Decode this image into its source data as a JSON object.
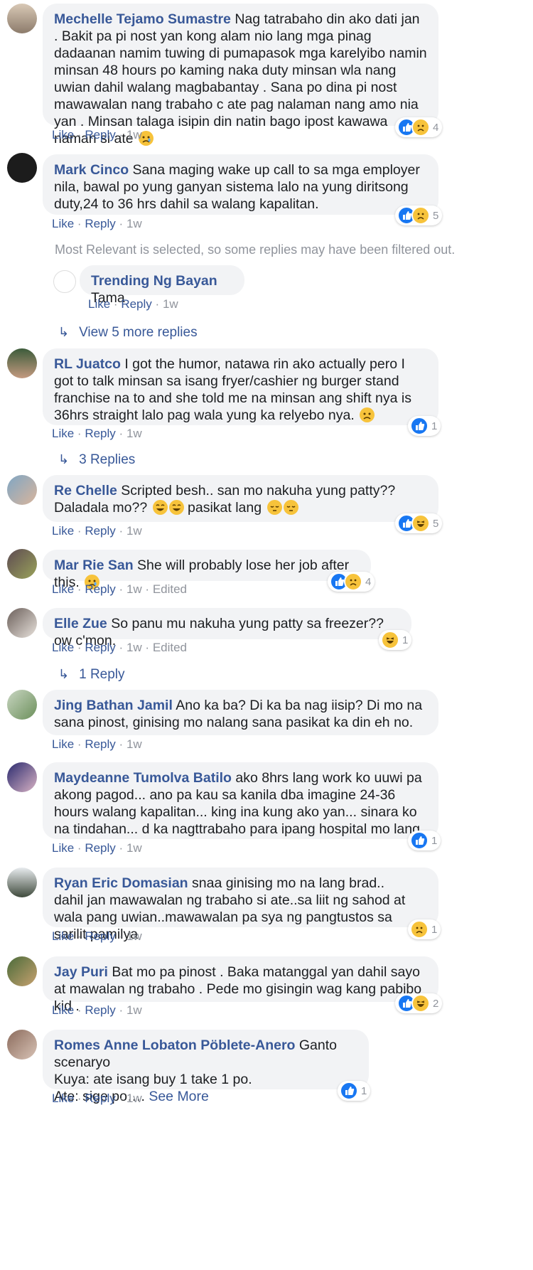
{
  "actions": {
    "like": "Like",
    "reply": "Reply",
    "dot": "·",
    "edited": "Edited"
  },
  "comments": [
    {
      "author": "Mechelle Tejamo Sumastre",
      "text": "Nag tatrabaho din ako dati jan . Bakit pa pi nost yan kong alam nio lang mga pinag dadaanan namim tuwing di pumapasok mga karelyibo namin minsan 48 hours po kaming naka duty minsan wla nang uwian dahil walang magbabantay . Sana po dina pi nost mawawalan nang trabaho c ate pag nalaman nang amo nia yan . Minsan talaga isipin din natin bago ipost kawawa naman si ate",
      "emoji": "sad",
      "time": "1w",
      "reactions": [
        "like",
        "sad"
      ],
      "count": "4"
    },
    {
      "author": "Mark Cinco",
      "text": "Sana maging wake up call to sa mga employer nila, bawal po yung ganyan sistema lalo na yung diritsong duty,24 to 36 hrs dahil sa walang kapalitan.",
      "time": "1w",
      "reactions": [
        "like",
        "sad"
      ],
      "count": "5"
    },
    {
      "author": "Trending Ng Bayan",
      "text": "Tama",
      "time": "1w"
    },
    {
      "author": "RL Juatco",
      "text": "I got the humor, natawa rin ako actually pero I got to talk minsan sa isang fryer/cashier ng burger stand franchise na to and she told me na minsan ang shift nya is 36hrs straight lalo pag wala yung ka relyebo nya.",
      "emoji": "frown",
      "time": "1w",
      "reactions": [
        "like"
      ],
      "count": "1"
    },
    {
      "author": "Re Chelle",
      "text": "Scripted besh.. san mo nakuha yung patty?? Daladala mo??",
      "text2": "pasikat lang",
      "time": "1w",
      "reactions": [
        "like",
        "haha"
      ],
      "count": "5"
    },
    {
      "author": "Mar Rie San",
      "text": "She will probably lose her job after this.",
      "emoji": "sad",
      "time": "1w",
      "edited": true,
      "reactions": [
        "like",
        "sad"
      ],
      "count": "4"
    },
    {
      "author": "Elle Zue",
      "text": "So panu mu nakuha yung patty sa freezer??ow c'mon.",
      "time": "1w",
      "edited": true,
      "reactions": [
        "haha"
      ],
      "count": "1"
    },
    {
      "author": "Jing Bathan Jamil",
      "text": "Ano ka ba? Di ka ba nag iisip? Di mo na sana pinost, ginising mo nalang sana pasikat ka din eh no.",
      "time": "1w"
    },
    {
      "author": "Maydeanne Tumolva Batilo",
      "text": "ako 8hrs lang work ko uuwi pa akong pagod... ano pa kau sa kanila dba imagine 24-36 hours walang kapalitan... king ina kung ako yan... sinara ko na tindahan... d ka nagttrabaho para ipang hospital mo lang",
      "time": "1w",
      "reactions": [
        "like"
      ],
      "count": "1"
    },
    {
      "author": "Ryan Eric Domasian",
      "text": "snaa ginising mo na lang brad..",
      "text2": "dahil jan mawawalan ng trabaho si ate..sa liit ng sahod at wala pang uwian..mawawalan pa sya ng pangtustos sa sarilit pamilya",
      "time": "1w",
      "reactions": [
        "sad"
      ],
      "count": "1"
    },
    {
      "author": "Jay Puri",
      "text": "Bat mo pa pinost . Baka matanggal yan dahil sayo at mawalan ng trabaho . Pede mo gisingin wag kang pabibo kid .",
      "time": "1w",
      "reactions": [
        "like",
        "haha"
      ],
      "count": "2"
    },
    {
      "author": "Romes Anne Lobaton Pöblete-Anero",
      "text": "Ganto scenaryo",
      "text2": "Kuya: ate isang buy 1 take 1 po.",
      "text3": "Ate: sige po….",
      "see_more": "See More",
      "time": "1w",
      "reactions": [
        "like"
      ],
      "count": "1"
    }
  ],
  "filter_note": "Most Relevant is selected, so some replies may have been filtered out.",
  "more_replies": {
    "view5": "View 5 more replies",
    "three": "3 Replies",
    "one": "1 Reply"
  },
  "arrow": "↳",
  "colors": {
    "link": "#385898",
    "muted": "#90949c",
    "bubble": "#f2f3f5",
    "like": "#1877f2",
    "emoji": "#f7c33b"
  }
}
